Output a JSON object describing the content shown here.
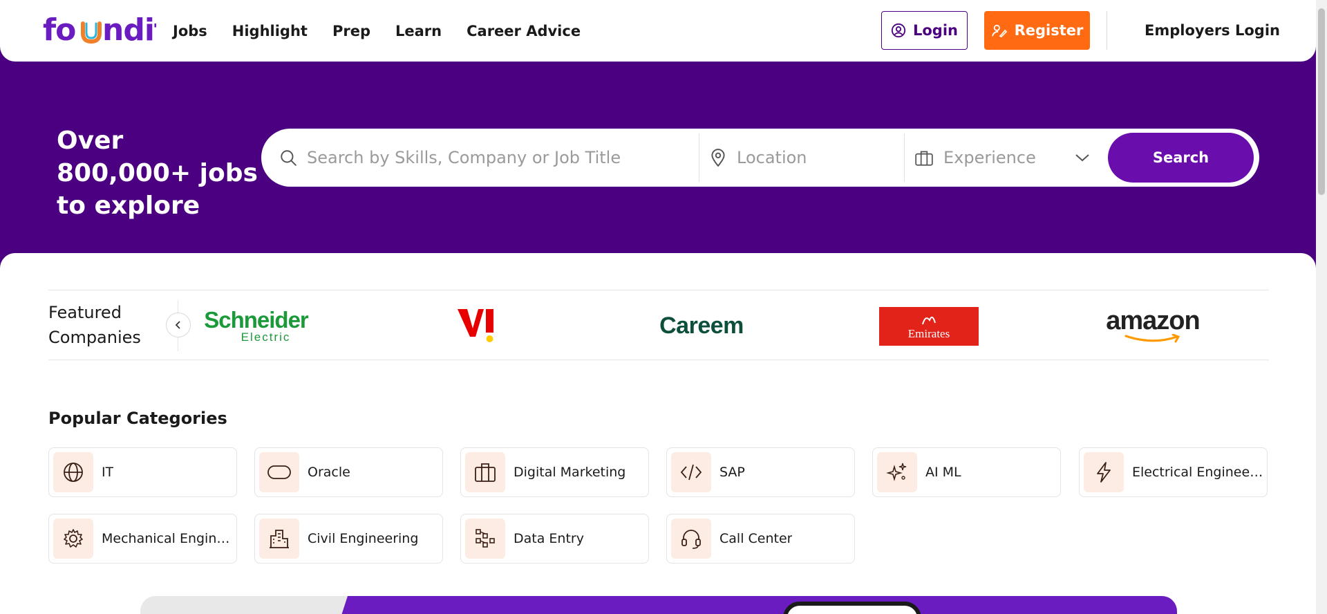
{
  "header": {
    "logo": "foundit",
    "nav": [
      "Jobs",
      "Highlight",
      "Prep",
      "Learn",
      "Career Advice"
    ],
    "login_label": "Login",
    "register_label": "Register",
    "employers_label": "Employers Login"
  },
  "hero": {
    "title": "Over 800,000+ jobs to explore",
    "search": {
      "skills_placeholder": "Search by Skills, Company or Job Title",
      "location_placeholder": "Location",
      "experience_placeholder": "Experience",
      "button_label": "Search"
    }
  },
  "featured": {
    "title": "Featured Companies",
    "companies": [
      {
        "name": "Schneider",
        "sub": "Electric"
      },
      {
        "name": "Vi"
      },
      {
        "name": "Careem"
      },
      {
        "name": "Emirates"
      },
      {
        "name": "amazon"
      }
    ]
  },
  "popular": {
    "title": "Popular Categories",
    "categories": [
      {
        "label": "IT",
        "icon": "globe-icon"
      },
      {
        "label": "Oracle",
        "icon": "pill-shape-icon"
      },
      {
        "label": "Digital Marketing",
        "icon": "briefcase-icon"
      },
      {
        "label": "SAP",
        "icon": "code-icon"
      },
      {
        "label": "AI ML",
        "icon": "sparkles-icon"
      },
      {
        "label": "Electrical Engineering",
        "icon": "lightning-icon"
      },
      {
        "label": "Mechanical Enginee...",
        "icon": "gear-icon"
      },
      {
        "label": "Civil Engineering",
        "icon": "building-icon"
      },
      {
        "label": "Data Entry",
        "icon": "data-blocks-icon"
      },
      {
        "label": "Call Center",
        "icon": "headset-icon"
      }
    ]
  },
  "colors": {
    "primary_purple": "#4b0082",
    "button_purple": "#6a0dad",
    "register_orange": "#ff6a13",
    "category_icon_bg": "#fdece4"
  }
}
